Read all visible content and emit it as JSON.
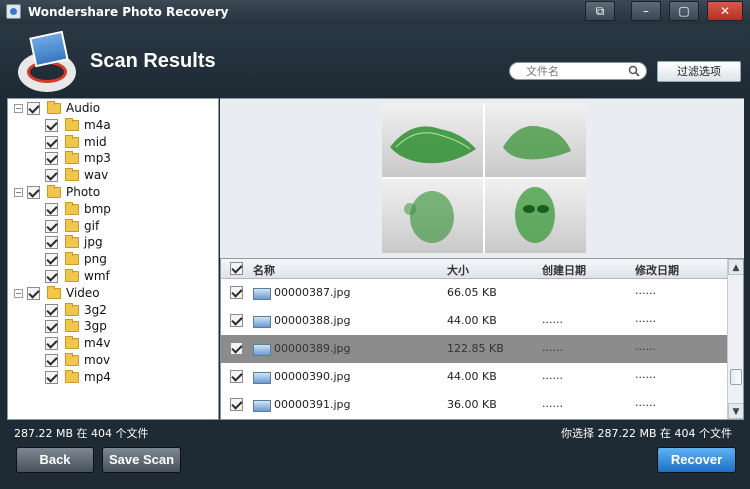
{
  "window": {
    "title": "Wondershare Photo Recovery",
    "buttons": {
      "restore": "⧉",
      "minimize": "–",
      "maximize": "▢",
      "close": "✕"
    }
  },
  "header": {
    "title": "Scan Results",
    "search": {
      "placeholder": "文件名",
      "icon": "search-icon"
    },
    "filter_button": "过滤选项"
  },
  "tree": [
    {
      "label": "Audio",
      "level": 0,
      "expanded": true,
      "checked": true
    },
    {
      "label": "m4a",
      "level": 1,
      "checked": true
    },
    {
      "label": "mid",
      "level": 1,
      "checked": true
    },
    {
      "label": "mp3",
      "level": 1,
      "checked": true
    },
    {
      "label": "wav",
      "level": 1,
      "checked": true
    },
    {
      "label": "Photo",
      "level": 0,
      "expanded": true,
      "checked": true
    },
    {
      "label": "bmp",
      "level": 1,
      "checked": true
    },
    {
      "label": "gif",
      "level": 1,
      "checked": true
    },
    {
      "label": "jpg",
      "level": 1,
      "checked": true
    },
    {
      "label": "png",
      "level": 1,
      "checked": true
    },
    {
      "label": "wmf",
      "level": 1,
      "checked": true
    },
    {
      "label": "Video",
      "level": 0,
      "expanded": true,
      "checked": true
    },
    {
      "label": "3g2",
      "level": 1,
      "checked": true
    },
    {
      "label": "3gp",
      "level": 1,
      "checked": true
    },
    {
      "label": "m4v",
      "level": 1,
      "checked": true
    },
    {
      "label": "mov",
      "level": 1,
      "checked": true
    },
    {
      "label": "mp4",
      "level": 1,
      "checked": true
    }
  ],
  "table": {
    "columns": {
      "name": "名称",
      "size": "大小",
      "created": "创建日期",
      "modified": "修改日期"
    },
    "rows": [
      {
        "name": "00000387.jpg",
        "size": "66.05 KB",
        "created": "",
        "modified": "......",
        "checked": true,
        "selected": false
      },
      {
        "name": "00000388.jpg",
        "size": "44.00 KB",
        "created": "......",
        "modified": "......",
        "checked": true,
        "selected": false
      },
      {
        "name": "00000389.jpg",
        "size": "122.85 KB",
        "created": "......",
        "modified": "......",
        "checked": true,
        "selected": true
      },
      {
        "name": "00000390.jpg",
        "size": "44.00 KB",
        "created": "......",
        "modified": "......",
        "checked": true,
        "selected": false
      },
      {
        "name": "00000391.jpg",
        "size": "36.00 KB",
        "created": "......",
        "modified": "......",
        "checked": true,
        "selected": false
      }
    ]
  },
  "status": {
    "left": "287.22 MB 在 404 个文件",
    "right": "你选择 287.22 MB 在 404 个文件"
  },
  "buttons": {
    "back": "Back",
    "save_scan": "Save Scan",
    "recover": "Recover"
  },
  "colors": {
    "accent": "#1c6fc4",
    "selected_row": "#8c8c8c",
    "folder": "#f2c64b"
  }
}
